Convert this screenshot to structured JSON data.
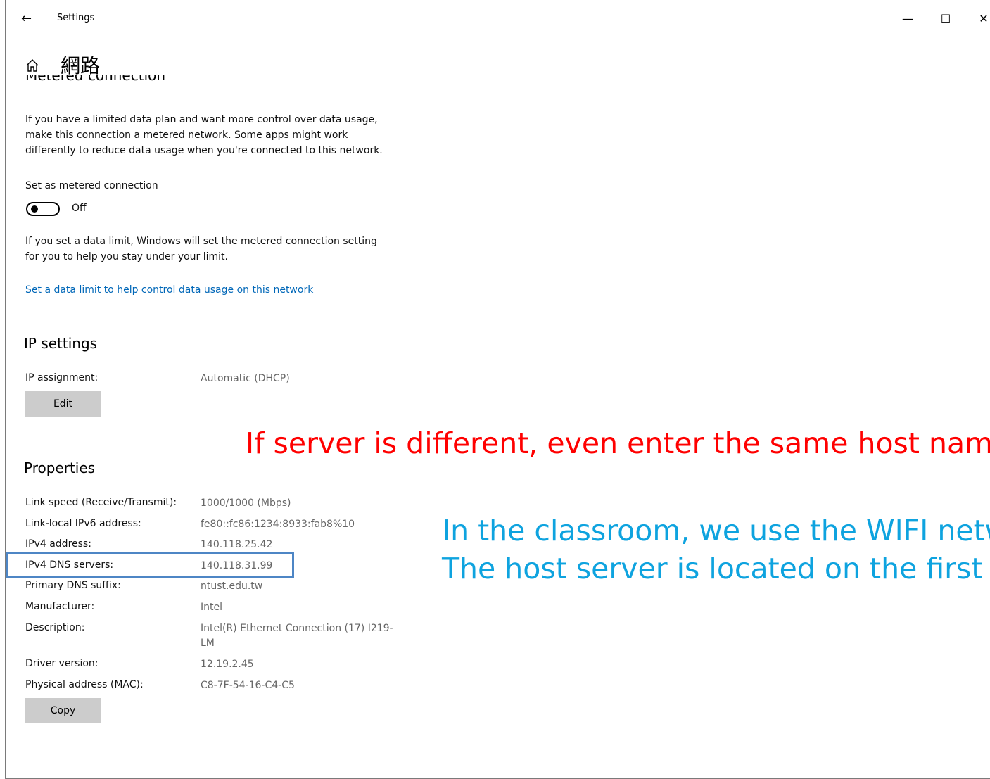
{
  "window": {
    "title": "Settings",
    "back_icon": "←",
    "minimize_icon": "—",
    "maximize_icon": "☐",
    "close_icon": "✕"
  },
  "page": {
    "title": "網路",
    "cut_heading": "Metered connection"
  },
  "metered": {
    "description": [
      "If you have a limited data plan and want more control over data usage,",
      "make this connection a metered network. Some apps might work",
      "differently to reduce data usage when you're connected to this network."
    ],
    "set_label": "Set as metered connection",
    "toggle_state": "Off",
    "limit_description": [
      "If you set a data limit, Windows will set the metered connection setting",
      "for you to help you stay under your limit."
    ],
    "limit_link": "Set a data limit to help control data usage on this network"
  },
  "ip_settings": {
    "heading": "IP settings",
    "assignment_label": "IP assignment:",
    "assignment_value": "Automatic (DHCP)",
    "edit_button": "Edit"
  },
  "properties": {
    "heading": "Properties",
    "rows": [
      {
        "label": "Link speed (Receive/Transmit):",
        "value": "1000/1000 (Mbps)"
      },
      {
        "label": "Link-local IPv6 address:",
        "value": "fe80::fc86:1234:8933:fab8%10"
      },
      {
        "label": "IPv4 address:",
        "value": "140.118.25.42"
      },
      {
        "label": "IPv4 DNS servers:",
        "value": "140.118.31.99"
      },
      {
        "label": "Primary DNS suffix:",
        "value": "ntust.edu.tw"
      },
      {
        "label": "Manufacturer:",
        "value": "Intel"
      },
      {
        "label": "Description:",
        "value": "Intel(R) Ethernet Connection (17) I219-",
        "value2": "LM"
      },
      {
        "label": "Driver version:",
        "value": "12.19.2.45"
      },
      {
        "label": "Physical address (MAC):",
        "value": "C8-7F-54-16-C4-C5"
      }
    ],
    "copy_button": "Copy"
  },
  "annotations": {
    "red": "If server is different, even enter the same host name",
    "blue_line1": "In the classroom, we use the WIFI network",
    "blue_line2": "The host server is located on the first floor",
    "colors": {
      "red": "#ff0000",
      "blue": "#0ea3df",
      "box": "#4e86c5"
    }
  }
}
